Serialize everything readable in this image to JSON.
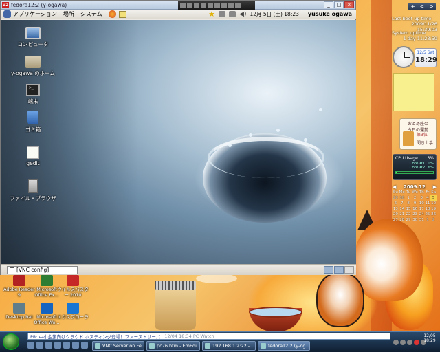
{
  "vnc_window": {
    "title": "fedora12:2 (y-ogawa)",
    "icon_label": "V2",
    "controls": [
      "_",
      "□",
      "x"
    ]
  },
  "guest_panel": {
    "menus": [
      "アプリケーション",
      "場所",
      "システム"
    ],
    "clock": "12月 5日 (土) 18:23",
    "user": "yusuke ogawa"
  },
  "guest_desktop_icons": [
    {
      "label": "コンピュータ",
      "icon": "computer-icon"
    },
    {
      "label": "y-ogawa のホーム",
      "icon": "home-folder-icon"
    },
    {
      "label": "端末",
      "icon": "terminal-icon"
    },
    {
      "label": "ゴミ箱",
      "icon": "trash-icon"
    },
    {
      "label": "gedit",
      "icon": "text-editor-icon"
    },
    {
      "label": "ファイル・ブラウザ",
      "icon": "file-browser-icon"
    }
  ],
  "guest_bottom_panel": {
    "task_label": "[VNC config]"
  },
  "host_desktop_icons": [
    {
      "label": "Adobe Reader 9",
      "color": "#b22222"
    },
    {
      "label": "Microsoft Office Ex...",
      "color": "#2e7d32"
    },
    {
      "label": "ウイルスバスター 2010",
      "color": "#c62828"
    },
    {
      "label": "Desktop.bat",
      "color": "#607d8b"
    },
    {
      "label": "Microsoft Office Wo...",
      "color": "#1565c0"
    },
    {
      "label": "エクスプローラ",
      "color": "#1976d2"
    }
  ],
  "sidebar": {
    "top_buttons": [
      "+",
      "<",
      ">"
    ],
    "last_boot_label": "Last boot up time",
    "last_boot_value": "2009/11/26 15:39:03",
    "uptime_label": "System uptime",
    "uptime_value": "1 day 11:23:59",
    "digital_clock_date": "12/5 Sat",
    "digital_clock_time": "18:29",
    "omikuji_title": "おとめ座の",
    "omikuji_subtitle": "今日の運勢",
    "omikuji_rank": "第3位",
    "omikuji_text": "聞き上手",
    "cpu_title": "CPU Usage",
    "cpu_total": "3%",
    "cpu_cores": [
      {
        "label": "Core #1",
        "value": "0%"
      },
      {
        "label": "Core #2",
        "value": "6%"
      }
    ],
    "calendar_month": "2009.12",
    "calendar_days": [
      "Su",
      "Mo",
      "Tu",
      "We",
      "Th",
      "Fr",
      "Sa"
    ],
    "calendar_rows": [
      [
        "29",
        "30",
        "1",
        "2",
        "3",
        "4",
        "5"
      ],
      [
        "6",
        "7",
        "8",
        "9",
        "10",
        "11",
        "12"
      ],
      [
        "13",
        "14",
        "15",
        "16",
        "17",
        "18",
        "19"
      ],
      [
        "20",
        "21",
        "22",
        "23",
        "24",
        "25",
        "26"
      ],
      [
        "27",
        "28",
        "29",
        "30",
        "31",
        "1",
        "2"
      ]
    ]
  },
  "host_taskbar": {
    "ticker_text": "PR: 中小企業向けクラウド ホスティング登場！ファーストサーバ",
    "ticker_meta": "12/04 18:34 PC Watch",
    "buttons": [
      {
        "label": "VNC Server on Fe..."
      },
      {
        "label": "pc76.htm - EmEdi..."
      },
      {
        "label": "192.168.1.2:22 - ..."
      },
      {
        "label": "fedora12:2 (y-og..."
      }
    ],
    "clock_time": "18:29",
    "clock_date": "12/05"
  }
}
